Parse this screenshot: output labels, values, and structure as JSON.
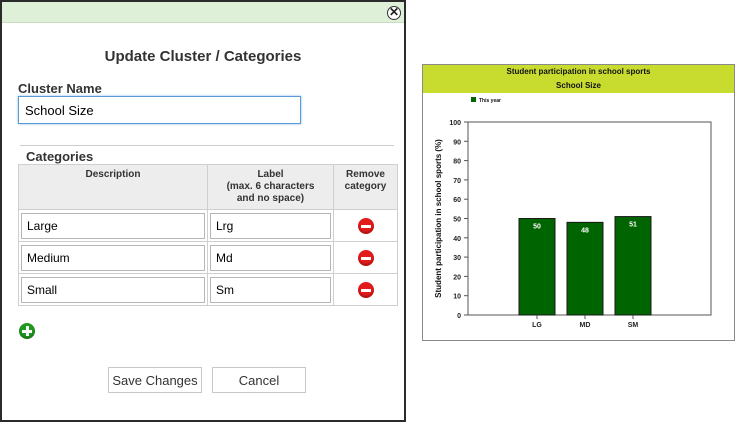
{
  "dialog": {
    "title": "Update Cluster / Categories",
    "cluster_name_label": "Cluster Name",
    "cluster_name_value": "School Size",
    "categories_label": "Categories",
    "columns": {
      "description": "Description",
      "label": "Label\n(max. 6 characters\nand no space)",
      "remove": "Remove\ncategory"
    },
    "rows": [
      {
        "description": "Large",
        "label": "Lrg"
      },
      {
        "description": "Medium",
        "label": "Md"
      },
      {
        "description": "Small",
        "label": "Sm"
      }
    ],
    "save_label": "Save Changes",
    "cancel_label": "Cancel",
    "close_glyph": "✕"
  },
  "chart_data": {
    "type": "bar",
    "title": "Student participation in school sports",
    "subtitle": "School Size",
    "ylabel": "Student participation in school sports (%)",
    "xlabel": "",
    "categories": [
      "LG",
      "MD",
      "SM"
    ],
    "series": [
      {
        "name": "This year",
        "values": [
          50,
          48,
          51
        ]
      }
    ],
    "ylim": [
      0,
      100
    ],
    "yticks": [
      0,
      10,
      20,
      30,
      40,
      50,
      60,
      70,
      80,
      90,
      100
    ],
    "bar_color": "#006400",
    "header_color": "#c8dc30",
    "legend": "top-left"
  }
}
